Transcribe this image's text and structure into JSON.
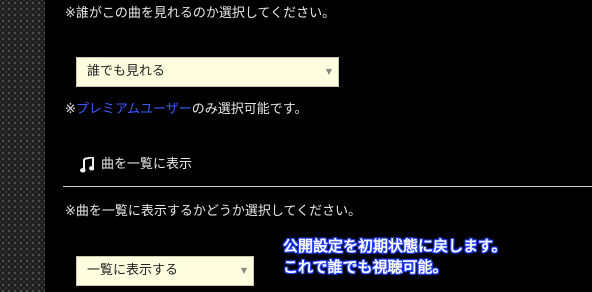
{
  "visibility": {
    "instruction": "※誰がこの曲を見れるのか選択してください。",
    "select_value": "誰でも見れる",
    "note_prefix": "※",
    "note_link": "プレミアムユーザー",
    "note_suffix": "のみ選択可能です。"
  },
  "listing": {
    "heading": "曲を一覧に表示",
    "icon": "music-note-icon",
    "instruction": "※曲を一覧に表示するかどうか選択してください。",
    "select_value": "一覧に表示する"
  },
  "annotation": {
    "line1": "公開設定を初期状態に戻します。",
    "line2": "これで誰でも視聴可能。"
  },
  "colors": {
    "link": "#3b5bff",
    "select_bg": "#fffde0",
    "annotation_outline": "#2240ff"
  }
}
